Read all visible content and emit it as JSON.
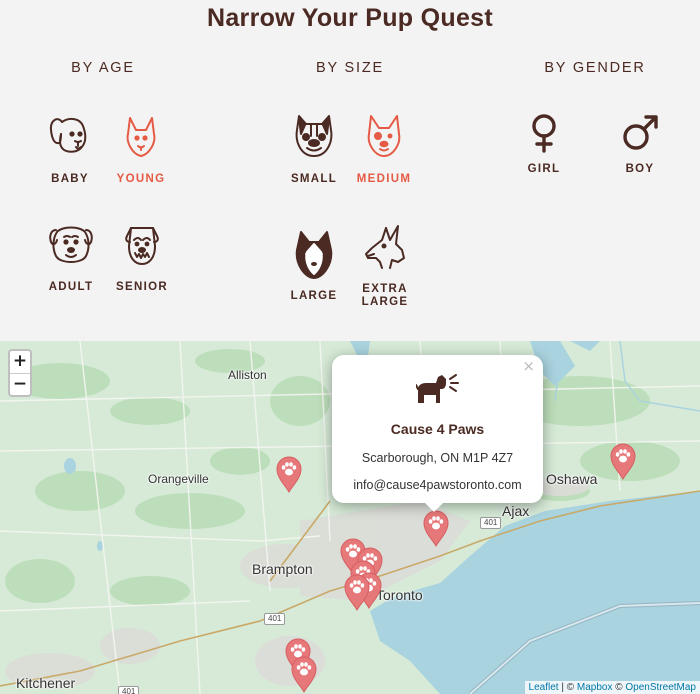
{
  "title": "Narrow Your Pup Quest",
  "groups": {
    "age": {
      "title": "BY AGE",
      "options": [
        {
          "label": "BABY",
          "icon": "baby-dog-icon",
          "active": false
        },
        {
          "label": "YOUNG",
          "icon": "young-dog-icon",
          "active": true
        },
        {
          "label": "ADULT",
          "icon": "adult-dog-icon",
          "active": false
        },
        {
          "label": "SENIOR",
          "icon": "senior-dog-icon",
          "active": false
        }
      ]
    },
    "size": {
      "title": "BY SIZE",
      "options": [
        {
          "label": "SMALL",
          "icon": "small-dog-icon",
          "active": false
        },
        {
          "label": "MEDIUM",
          "icon": "medium-dog-icon",
          "active": true
        },
        {
          "label": "LARGE",
          "icon": "large-dog-icon",
          "active": false
        },
        {
          "label_line1": "EXTRA",
          "label_line2": "LARGE",
          "icon": "extra-large-dog-icon",
          "active": false
        }
      ]
    },
    "gender": {
      "title": "BY GENDER",
      "options": [
        {
          "label": "GIRL",
          "icon": "female-symbol-icon",
          "active": false
        },
        {
          "label": "BOY",
          "icon": "male-symbol-icon",
          "active": false
        }
      ]
    }
  },
  "colors": {
    "accent": "#e55a44",
    "brown": "#4a2a22",
    "marker": "#e6787a",
    "water": "#a9d3df",
    "land": "#d6ead7"
  },
  "map": {
    "zoom_in": "+",
    "zoom_out": "−",
    "places": {
      "alliston": "Alliston",
      "orangeville": "Orangeville",
      "oshawa": "Oshawa",
      "ajax": "Ajax",
      "brampton": "Brampton",
      "toronto": "Toronto",
      "kitchener": "Kitchener"
    },
    "roads": {
      "r401a": "401",
      "r401b": "401",
      "r401c": "401"
    },
    "popup": {
      "icon": "dog-barking-icon",
      "name": "Cause 4 Paws",
      "address": "Scarborough, ON M1P 4Z7",
      "email": "info@cause4pawstoronto.com",
      "close": "×"
    },
    "attribution": {
      "leaflet": "Leaflet",
      "sep1": " | © ",
      "mapbox": "Mapbox",
      "sep2": " © ",
      "osm": "OpenStreetMap"
    }
  }
}
